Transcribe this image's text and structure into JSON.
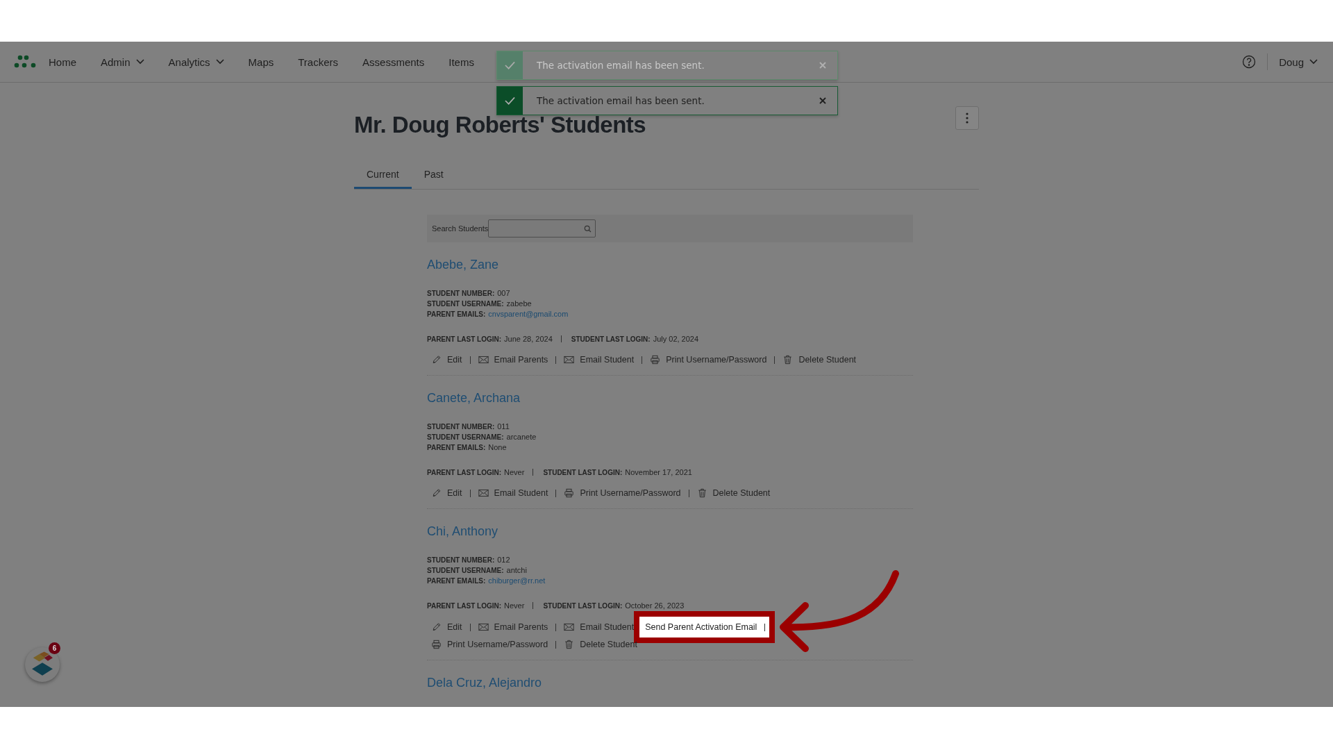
{
  "nav": {
    "items": [
      {
        "label": "Home",
        "dropdown": false
      },
      {
        "label": "Admin",
        "dropdown": true
      },
      {
        "label": "Analytics",
        "dropdown": true
      },
      {
        "label": "Maps",
        "dropdown": false
      },
      {
        "label": "Trackers",
        "dropdown": false
      },
      {
        "label": "Assessments",
        "dropdown": false
      },
      {
        "label": "Items",
        "dropdown": false
      }
    ],
    "user": "Doug"
  },
  "toasts": [
    {
      "message": "The activation email has been sent.",
      "faded": true
    },
    {
      "message": "The activation email has been sent.",
      "faded": false
    }
  ],
  "page": {
    "title": "Mr. Doug Roberts' Students"
  },
  "tabs": [
    {
      "label": "Current",
      "selected": true
    },
    {
      "label": "Past",
      "selected": false
    }
  ],
  "search": {
    "label": "Search Students"
  },
  "students": [
    {
      "name": "Abebe, Zane",
      "fields": [
        {
          "label": "STUDENT NUMBER:",
          "value": "007",
          "link": false
        },
        {
          "label": "STUDENT USERNAME:",
          "value": "zabebe",
          "link": false
        },
        {
          "label": "PARENT EMAILS:",
          "value": "cnvsparent@gmail.com",
          "link": true
        }
      ],
      "logins": [
        {
          "label": "PARENT LAST LOGIN:",
          "value": "June 28, 2024"
        },
        {
          "label": "STUDENT LAST LOGIN:",
          "value": "July 02, 2024"
        }
      ],
      "actions": [
        {
          "kind": "edit",
          "label": "Edit",
          "highlighted": false
        },
        {
          "kind": "email",
          "label": "Email Parents",
          "highlighted": false
        },
        {
          "kind": "email",
          "label": "Email Student",
          "highlighted": false
        },
        {
          "kind": "print",
          "label": "Print Username/Password",
          "highlighted": false
        },
        {
          "kind": "delete",
          "label": "Delete Student",
          "highlighted": false
        }
      ]
    },
    {
      "name": "Canete, Archana",
      "fields": [
        {
          "label": "STUDENT NUMBER:",
          "value": "011",
          "link": false
        },
        {
          "label": "STUDENT USERNAME:",
          "value": "arcanete",
          "link": false
        },
        {
          "label": "PARENT EMAILS:",
          "value": "None",
          "link": false
        }
      ],
      "logins": [
        {
          "label": "PARENT LAST LOGIN:",
          "value": "Never"
        },
        {
          "label": "STUDENT LAST LOGIN:",
          "value": "November 17, 2021"
        }
      ],
      "actions": [
        {
          "kind": "edit",
          "label": "Edit",
          "highlighted": false
        },
        {
          "kind": "email",
          "label": "Email Student",
          "highlighted": false
        },
        {
          "kind": "print",
          "label": "Print Username/Password",
          "highlighted": false
        },
        {
          "kind": "delete",
          "label": "Delete Student",
          "highlighted": false
        }
      ]
    },
    {
      "name": "Chi, Anthony",
      "fields": [
        {
          "label": "STUDENT NUMBER:",
          "value": "012",
          "link": false
        },
        {
          "label": "STUDENT USERNAME:",
          "value": "antchi",
          "link": false
        },
        {
          "label": "PARENT EMAILS:",
          "value": "chiburger@rr.net",
          "link": true
        }
      ],
      "logins": [
        {
          "label": "PARENT LAST LOGIN:",
          "value": "Never"
        },
        {
          "label": "STUDENT LAST LOGIN:",
          "value": "October 26, 2023"
        }
      ],
      "actions": [
        {
          "kind": "edit",
          "label": "Edit",
          "highlighted": false
        },
        {
          "kind": "email",
          "label": "Email Parents",
          "highlighted": false
        },
        {
          "kind": "email",
          "label": "Email Student",
          "highlighted": false
        },
        {
          "kind": "activation",
          "label": "Send Parent Activation Email",
          "highlighted": true
        },
        {
          "kind": "print",
          "label": "Print Username/Password",
          "highlighted": false
        },
        {
          "kind": "delete",
          "label": "Delete Student",
          "highlighted": false
        }
      ]
    },
    {
      "name": "Dela Cruz, Alejandro"
    }
  ],
  "helper_widget": {
    "badge": "6"
  }
}
